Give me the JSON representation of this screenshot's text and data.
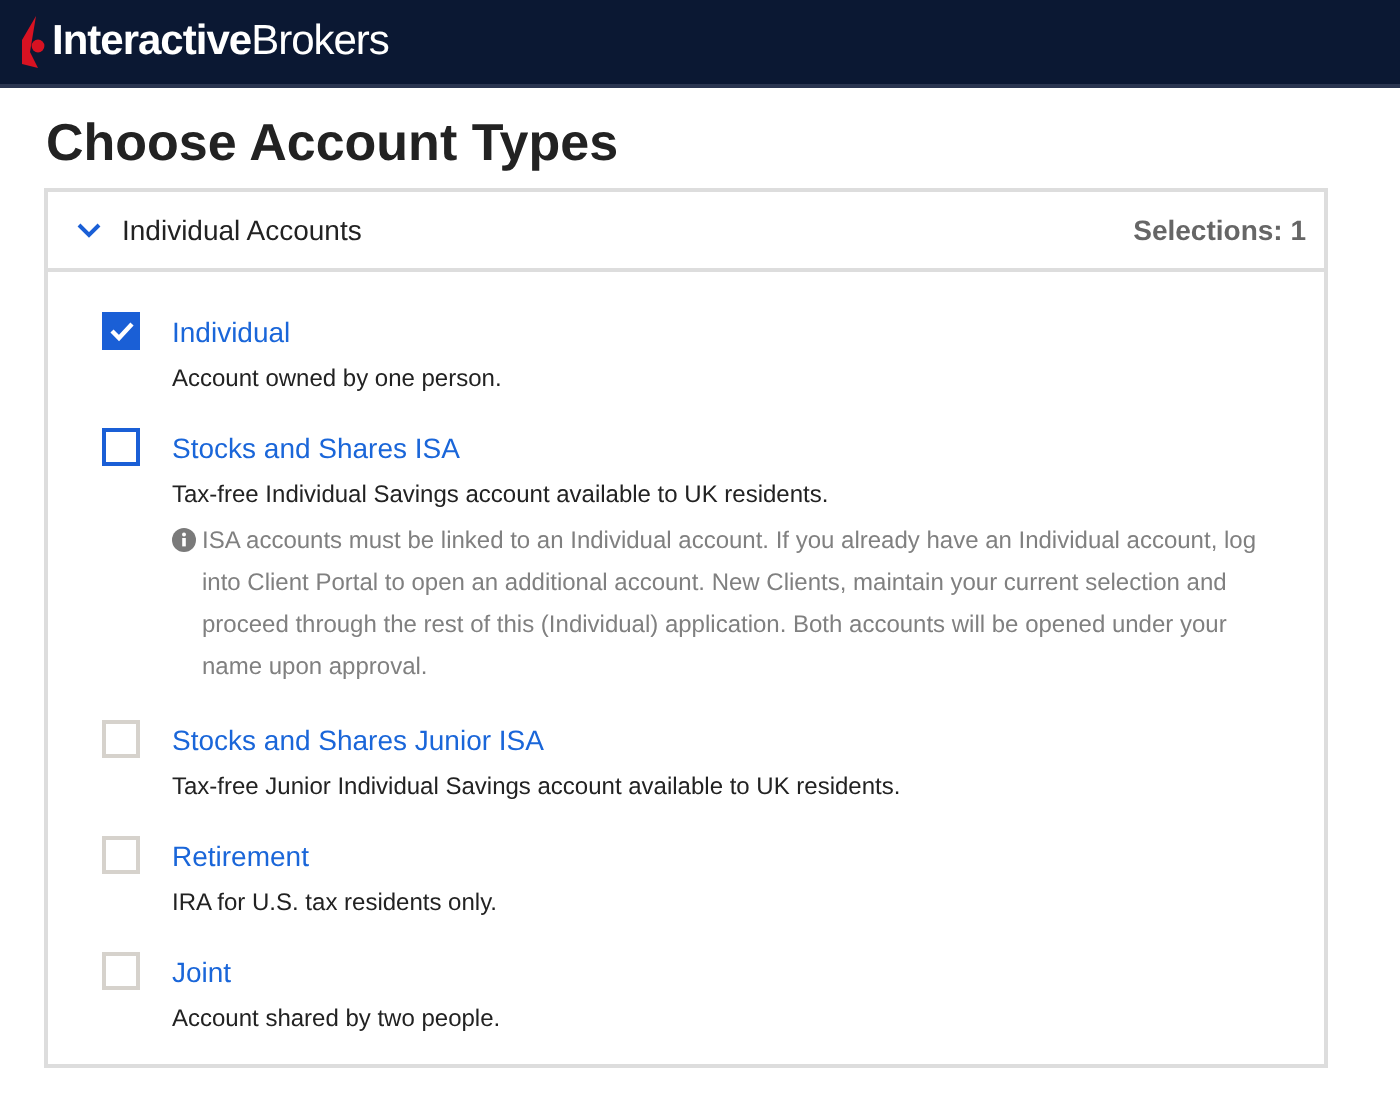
{
  "header": {
    "logo": "**Interactive**Brokers"
  },
  "page_title": "Choose Account Types",
  "section": {
    "title": "Individual Accounts",
    "expanded": true,
    "selections": "Selections: 1",
    "options": [
      {
        "label": "Individual",
        "description": "Account owned by one person.",
        "checked": true,
        "disabled": false
      },
      {
        "label": "Stocks and Shares ISA",
        "description": "Tax-free Individual Savings account available to UK residents.",
        "checked": false,
        "disabled": false,
        "note": "ISA accounts must be linked to an Individual account. If you already have an Individual account, log into Client Portal to open an additional account. New Clients, maintain your current selection and proceed through the rest of this (Individual) application. Both accounts will be opened under your name upon approval."
      },
      {
        "label": "Stocks and Shares Junior ISA",
        "description": "Tax-free Junior Individual Savings account available to UK residents.",
        "checked": false,
        "disabled": true
      },
      {
        "label": "Retirement",
        "description": "IRA for U.S. tax residents only.",
        "checked": false,
        "disabled": true
      },
      {
        "label": "Joint",
        "description": "Account shared by two people.",
        "checked": false,
        "disabled": true
      }
    ]
  }
}
